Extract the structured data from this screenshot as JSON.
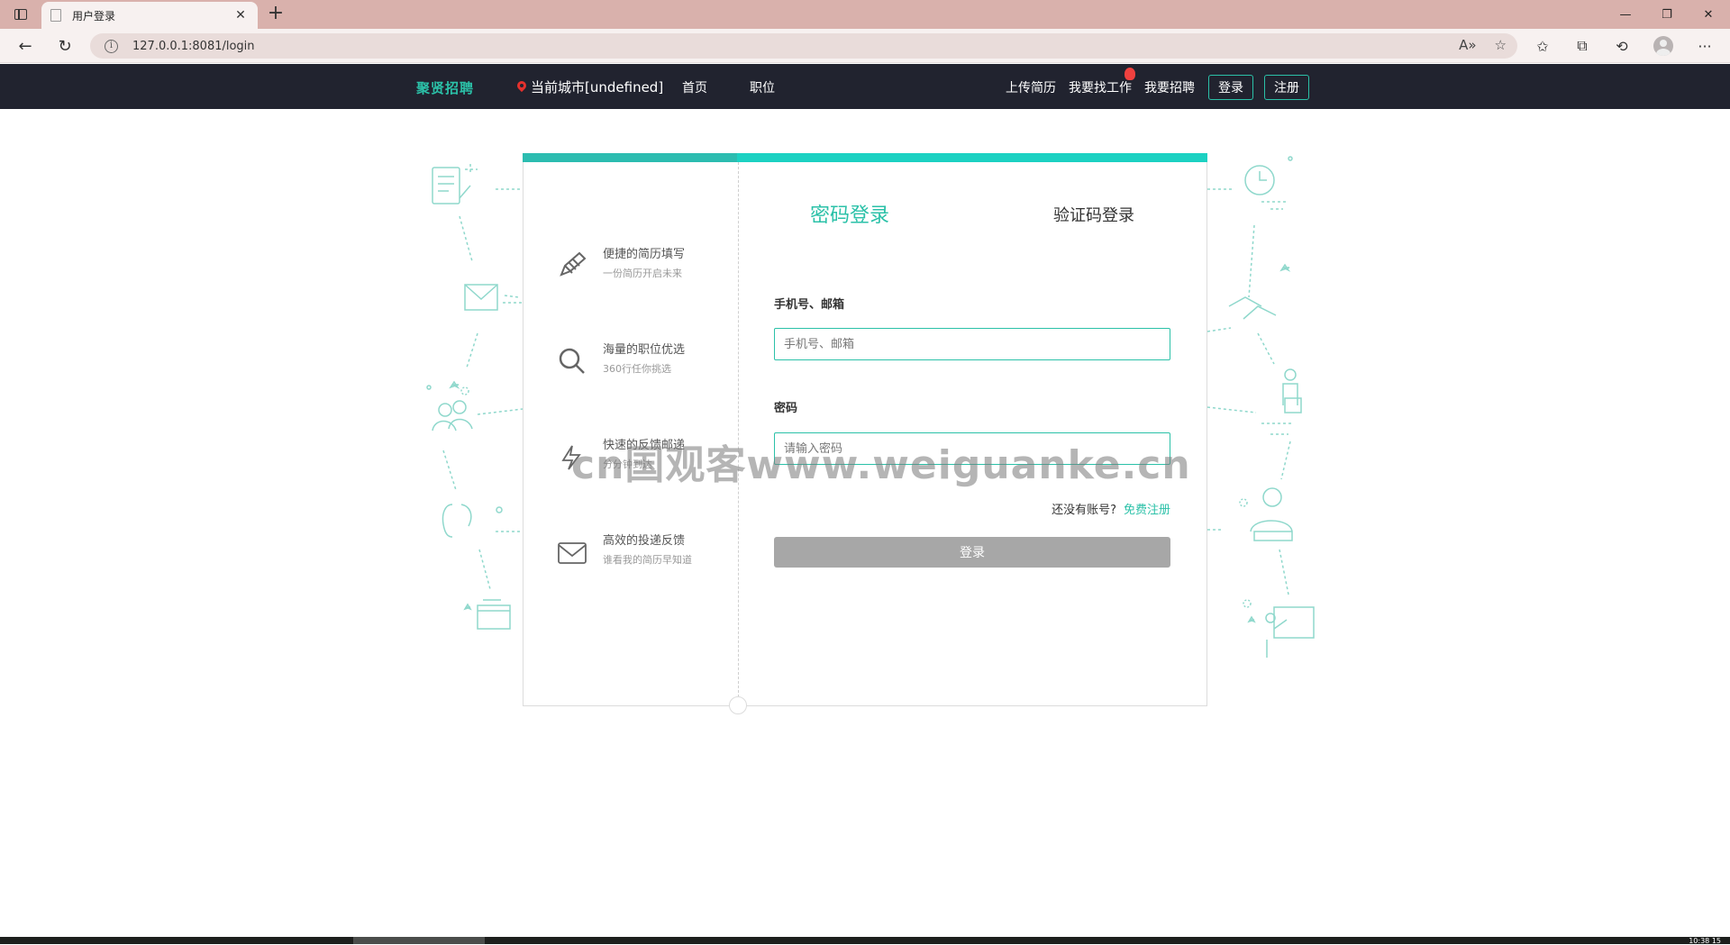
{
  "browser": {
    "tab_title": "用户登录",
    "tab_close": "✕",
    "new_tab": "+",
    "url": "127.0.0.1:8081/login",
    "info_glyph": "i",
    "win_minimize": "—",
    "win_restore": "❐",
    "win_close": "✕",
    "back_glyph": "←",
    "reload_glyph": "↻",
    "read_aloud_glyph": "A»",
    "favorite_glyph": "☆",
    "favorites_glyph": "✩",
    "collections_glyph": "⧉",
    "history_glyph": "⟲",
    "more_glyph": "···"
  },
  "header": {
    "logo": "聚贤招聘",
    "city": "当前城市[undefined]",
    "nav": [
      "首页",
      "职位"
    ],
    "upload_resume": "上传简历",
    "find_job": "我要找工作",
    "recruit": "我要招聘",
    "login_button": "登录",
    "register_button": "注册"
  },
  "features": [
    {
      "title": "便捷的简历填写",
      "subtitle": "一份简历开启未来",
      "icon": "pencil-icon"
    },
    {
      "title": "海量的职位优选",
      "subtitle": "360行任你挑选",
      "icon": "magnifier-icon"
    },
    {
      "title": "快速的反馈邮递",
      "subtitle": "分分钟到达",
      "icon": "lightning-icon"
    },
    {
      "title": "高效的投递反馈",
      "subtitle": "谁看我的简历早知道",
      "icon": "mail-icon"
    }
  ],
  "login": {
    "tab_password": "密码登录",
    "tab_code": "验证码登录",
    "account_label": "手机号、邮箱",
    "account_placeholder": "手机号、邮箱",
    "password_label": "密码",
    "password_placeholder": "请输入密码",
    "no_account": "还没有账号?",
    "free_register": "免费注册",
    "submit": "登录"
  },
  "watermark": "cn国观客www.weiguanke.cn",
  "taskbar": {
    "clock": "10:38 15"
  },
  "colors": {
    "accent": "#2bc1a8",
    "header_bg": "#21232f",
    "tab_bar": "#d9b1ac"
  }
}
